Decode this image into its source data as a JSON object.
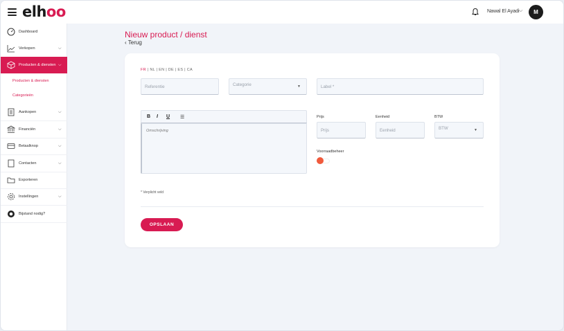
{
  "brand": {
    "logo_prefix": "elh",
    "logo_accent": "oo",
    "accent_color": "#d81b52"
  },
  "header": {
    "user_name": "Nawal El Ayadi",
    "user_chevron": "⌵",
    "avatar_initials": "M"
  },
  "sidebar": {
    "items": [
      {
        "label": "Dashboard",
        "icon": "dashboard-icon",
        "chevron": ""
      },
      {
        "label": "Verkopen",
        "icon": "chart-icon",
        "chevron": "⌵"
      },
      {
        "label": "Producten & diensten",
        "icon": "box-icon",
        "chevron": "⌵",
        "active": true
      },
      {
        "label": "Aankopen",
        "icon": "document-icon",
        "chevron": "⌵"
      },
      {
        "label": "Financiën",
        "icon": "bank-icon",
        "chevron": "⌵"
      },
      {
        "label": "Betaalknop",
        "icon": "card-icon",
        "chevron": "⌵"
      },
      {
        "label": "Contacten",
        "icon": "contacts-icon",
        "chevron": "⌵"
      },
      {
        "label": "Exporteren",
        "icon": "folder-icon",
        "chevron": ""
      },
      {
        "label": "Instellingen",
        "icon": "gear-icon",
        "chevron": "⌵"
      },
      {
        "label": "Bijstand nodig?",
        "icon": "lifebuoy-icon",
        "chevron": ""
      }
    ],
    "subitems": [
      {
        "label": "Producten & diensten"
      },
      {
        "label": "Categorieën"
      }
    ]
  },
  "main": {
    "title": "Nieuw product / dienst",
    "back_label": "Terug",
    "languages": {
      "active": "FR",
      "rest": " | NL | EN | DE | ES | CA"
    },
    "fields": {
      "reference_placeholder": "Referentie",
      "category_placeholder": "Categorie",
      "label_placeholder": "Label *",
      "description_placeholder": "Omschrijving",
      "price_label": "Prijs",
      "price_placeholder": "Prijs",
      "unit_label": "Eenheid",
      "unit_placeholder": "Eenheid",
      "vat_label": "BTW",
      "vat_placeholder": "BTW",
      "stock_label": "Voorraadbeheer"
    },
    "editor_toolbar": {
      "bold": "B",
      "italic": "I",
      "underline": "U",
      "list": "☰"
    },
    "required_note": "* Verplicht veld",
    "save_label": "OPSLAAN"
  }
}
